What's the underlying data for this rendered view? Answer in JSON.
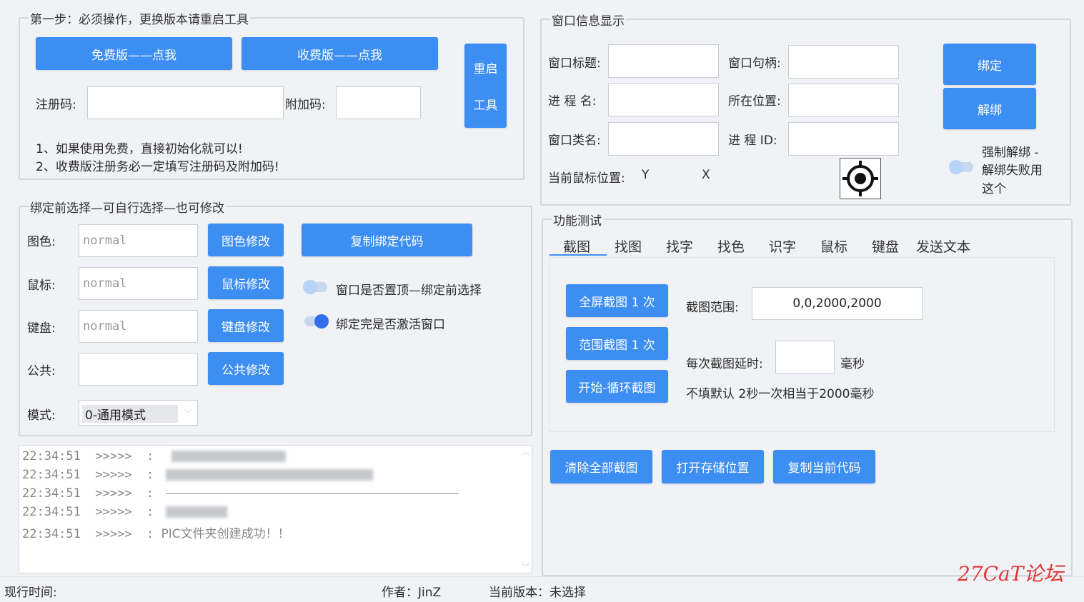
{
  "step1": {
    "title": "第一步：必须操作，更换版本请重启工具",
    "free_btn": "免费版——点我",
    "paid_btn": "收费版——点我",
    "restart_line1": "重启",
    "restart_line2": "工具",
    "reg_label": "注册码:",
    "reg_value": "",
    "extra_label": "附加码:",
    "extra_value": "",
    "note1": "1、如果使用免费，直接初始化就可以!",
    "note2": "2、收费版注册务必一定填写注册码及附加码!"
  },
  "bind_pre": {
    "title": "绑定前选择—可自行选择—也可修改",
    "rows": [
      {
        "label": "图色:",
        "value": "normal",
        "button": "图色修改"
      },
      {
        "label": "鼠标:",
        "value": "normal",
        "button": "鼠标修改"
      },
      {
        "label": "键盘:",
        "value": "normal",
        "button": "键盘修改"
      },
      {
        "label": "公共:",
        "value": "",
        "button": "公共修改"
      }
    ],
    "mode_label": "模式:",
    "mode_value": "0-通用模式",
    "copy_btn": "复制绑定代码",
    "toggle_top_label": "窗口是否置顶—绑定前选择",
    "toggle_top_on": false,
    "toggle_activate_label": "绑定完是否激活窗口",
    "toggle_activate_on": true
  },
  "log": {
    "lines": [
      {
        "time": "22:34:51",
        "arrow": ">>>>>",
        "sep": ":",
        "text": ""
      },
      {
        "time": "22:34:51",
        "arrow": ">>>>>",
        "sep": ":",
        "text": ""
      },
      {
        "time": "22:34:51",
        "arrow": ">>>>>",
        "sep": ":",
        "text": ""
      },
      {
        "time": "22:34:51",
        "arrow": ">>>>>",
        "sep": ":",
        "text": ""
      },
      {
        "time": "22:34:51",
        "arrow": ">>>>>",
        "sep": ":",
        "text": "PIC文件夹创建成功！！"
      }
    ]
  },
  "status": {
    "time_label": "现行时间:",
    "author": "作者：JinZ",
    "version": "当前版本：未选择"
  },
  "window_info": {
    "title": "窗口信息显示",
    "win_title_label": "窗口标题:",
    "win_handle_label": "窗口句柄:",
    "proc_name_label": "进 程 名:",
    "location_label": "所在位置:",
    "class_label": "窗口类名:",
    "pid_label": "进 程 ID:",
    "mouse_pos_label": "当前鼠标位置:",
    "y_label": "Y",
    "x_label": "X",
    "bind_btn": "绑定",
    "unbind_btn": "解绑",
    "force_unbind_line1": "强制解绑 -",
    "force_unbind_line2": "解绑失败用",
    "force_unbind_line3": "这个",
    "force_unbind_on": false,
    "crosshair_icon": "crosshair-target-icon"
  },
  "func_test": {
    "title": "功能测试",
    "tabs": [
      "截图",
      "找图",
      "找字",
      "找色",
      "识字",
      "鼠标",
      "键盘",
      "发送文本"
    ],
    "active_tab": "截图",
    "full_shot_btn": "全屏截图 1 次",
    "range_shot_btn": "范围截图 1 次",
    "loop_shot_btn": "开始-循环截图",
    "range_label": "截图范围:",
    "range_value": "0,0,2000,2000",
    "delay_label": "每次截图延时:",
    "delay_value": "",
    "delay_unit": "毫秒",
    "delay_note": "不填默认 2秒一次相当于2000毫秒",
    "clear_btn": "清除全部截图",
    "open_btn": "打开存储位置",
    "copy_btn": "复制当前代码"
  },
  "watermark": "27CaT论坛",
  "accent_color": "#3d8ef2"
}
